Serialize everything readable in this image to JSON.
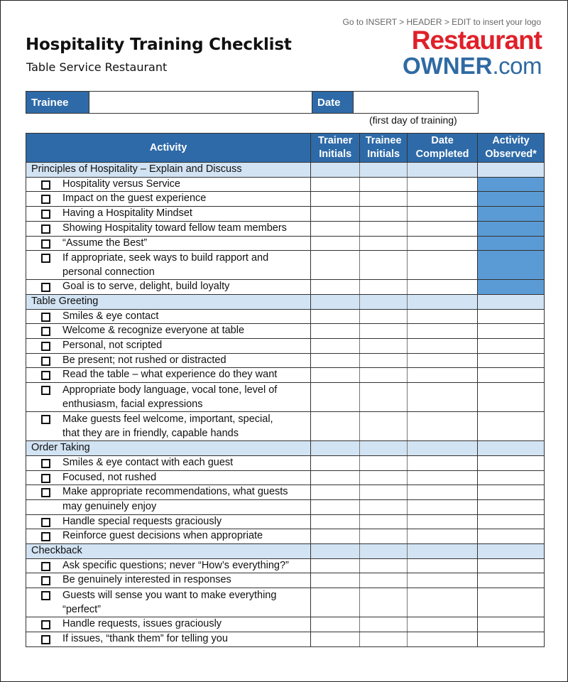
{
  "header": {
    "title": "Hospitality Training Checklist",
    "subtitle": "Table Service Restaurant",
    "logo_hint": "Go to INSERT > HEADER > EDIT to insert your logo",
    "logo_line1": "Restaurant",
    "logo_line2_bold": "OWNER",
    "logo_line2_rest": ".com"
  },
  "colors": {
    "header_blue": "#2e6aa8",
    "section_band": "#d2e3f3",
    "observed_fill": "#5b9bd5",
    "logo_red": "#e0202a",
    "logo_blue": "#2f6aa3"
  },
  "info": {
    "trainee_label": "Trainee",
    "trainee_value": "",
    "date_label": "Date",
    "date_value": "",
    "date_note": "(first day of training)"
  },
  "table": {
    "columns": [
      "Activity",
      "Trainer Initials",
      "Trainee Initials",
      "Date Completed",
      "Activity Observed*"
    ],
    "col_activity": "Activity",
    "col_trainer_1": "Trainer",
    "col_trainer_2": "Initials",
    "col_trainee_1": "Trainee",
    "col_trainee_2": "Initials",
    "col_date_1": "Date",
    "col_date_2": "Completed",
    "col_obs_1": "Activity",
    "col_obs_2": "Observed*",
    "sections": [
      {
        "title": "Principles of Hospitality – Explain and Discuss",
        "items": [
          {
            "text": "Hospitality versus Service",
            "checked": false,
            "observed_required": true
          },
          {
            "text": "Impact on the guest experience",
            "checked": false,
            "observed_required": true
          },
          {
            "text": "Having a Hospitality Mindset",
            "checked": false,
            "observed_required": true
          },
          {
            "text": "Showing Hospitality toward fellow team members",
            "checked": false,
            "observed_required": true
          },
          {
            "text": "“Assume the Best”",
            "checked": false,
            "observed_required": true
          },
          {
            "text": "If appropriate, seek ways to build rapport and personal connection",
            "line1": "If appropriate, seek ways to build rapport and",
            "line2": "personal connection",
            "checked": false,
            "observed_required": true
          },
          {
            "text": "Goal is to serve, delight, build loyalty",
            "checked": false,
            "observed_required": true
          }
        ]
      },
      {
        "title": "Table Greeting",
        "items": [
          {
            "text": "Smiles & eye contact",
            "checked": false
          },
          {
            "text": "Welcome & recognize everyone at table",
            "checked": false
          },
          {
            "text": "Personal, not scripted",
            "checked": false
          },
          {
            "text": "Be present; not rushed or distracted",
            "checked": false
          },
          {
            "text": "Read the table – what experience do they want",
            "checked": false
          },
          {
            "text": "Appropriate body language, vocal tone, level of enthusiasm, facial expressions",
            "line1": "Appropriate body language, vocal tone, level of",
            "line2": "enthusiasm, facial expressions",
            "checked": false
          },
          {
            "text": "Make guests feel welcome, important, special, that they are in friendly, capable hands",
            "line1": "Make guests feel welcome, important, special,",
            "line2": "that they are in friendly, capable hands",
            "checked": false
          }
        ]
      },
      {
        "title": "Order Taking",
        "items": [
          {
            "text": "Smiles & eye contact with each guest",
            "checked": false
          },
          {
            "text": "Focused, not rushed",
            "checked": false
          },
          {
            "text": "Make appropriate recommendations, what guests",
            "checked": false
          },
          {
            "text": "may genuinely enjoy",
            "continuation": true
          },
          {
            "text": "Handle special requests graciously",
            "checked": false
          },
          {
            "text": "Reinforce guest decisions when appropriate",
            "checked": false
          }
        ]
      },
      {
        "title": "Checkback",
        "items": [
          {
            "text": "Ask specific questions; never “How’s everything?”",
            "checked": false
          },
          {
            "text": "Be genuinely interested in responses",
            "checked": false
          },
          {
            "text": "Guests will sense you want to make everything “perfect”",
            "line1": "Guests will sense you want to make everything",
            "line2": "“perfect”",
            "checked": false
          },
          {
            "text": "Handle requests, issues graciously",
            "checked": false
          },
          {
            "text": "If issues, “thank them” for telling you",
            "checked": false
          }
        ]
      }
    ]
  }
}
